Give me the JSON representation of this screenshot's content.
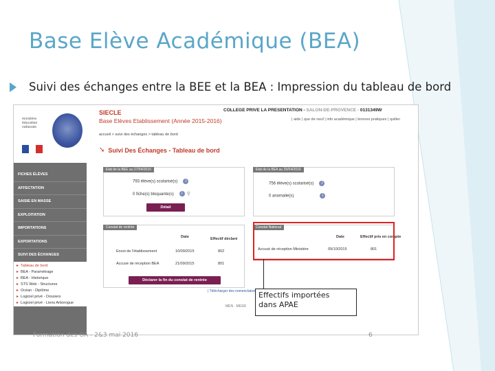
{
  "slide": {
    "title": "Base Elève Académique (BEA)",
    "bullet": "Suivi des échanges entre la BEE et la BEA : Impression du tableau de bord",
    "footer": "Formation des OA - 2&3 mai 2016",
    "page_number": "6",
    "callout_line1": "Effectifs importées",
    "callout_line2": "dans APAE"
  },
  "app": {
    "name": "SIECLE",
    "subtitle": "Base Elèves Etablissement (Année 2015-2016)",
    "school": "COLLEGE PRIVE LA PRESENTATION -",
    "city": "SALON-DE-PROVENCE -",
    "uai": "0131349W",
    "top_links": "| aide | que de neuf | info académique | bonnes pratiques | quitter",
    "breadcrumb": "accueil > suivi des échanges > tableau de bord",
    "page_title": "Suivi Des Échanges - Tableau de bord",
    "logo_text": "ministère éducation nationale"
  },
  "sidebar": {
    "items": [
      "FICHES ÉLÈVES",
      "AFFECTATION",
      "SAISIE EN MASSE",
      "EXPLOITATION",
      "IMPORTATIONS",
      "EXPORTATIONS",
      "SUIVI DES ÉCHANGES"
    ],
    "sub_items": [
      "Tableau de bord",
      "BEA - Paramétrage",
      "BEA - Historique",
      "STS Web - Structures",
      "Océan - Diplôme",
      "Logiciel privé - Dossiers",
      "Logiciel privé - Liens Arborogue"
    ]
  },
  "panel_bee": {
    "tab": "Etat de la BEE au 27/04/2016",
    "row1": "793 élève(s) scolarisé(s)",
    "row2": "0 fiche(s) bloquante(s)",
    "button": "Détail"
  },
  "panel_bea": {
    "tab": "Etat de la BEA au 25/04/2016",
    "row1": "756 élève(s) scolarisé(s)",
    "row2": "0 anomalie(s)"
  },
  "panel_constat": {
    "tab": "Constat de rentrée",
    "col_date": "Date",
    "col_effectif": "Effectif déclaré",
    "rows": [
      {
        "label": "Envoi de l'établissement",
        "date": "10/09/2015",
        "value": "802"
      },
      {
        "label": "Accusé de réception BEA",
        "date": "21/09/2015",
        "value": "801"
      }
    ],
    "button": "Déclarer la fin du constat de rentrée"
  },
  "panel_national": {
    "tab": "Constat National",
    "col_date": "Date",
    "col_effectif": "Effectif pris en compte",
    "rows": [
      {
        "label": "Accusé de réception Ministère",
        "date": "09/10/2015",
        "value": "801"
      }
    ]
  },
  "misc": {
    "nomenclature": "| Télécharger des nomenclatures",
    "bottom_links": "MEN · MESR"
  },
  "colors": {
    "accent": "#5aa6c8",
    "brand_red": "#c0392b",
    "button": "#7a1f52",
    "highlight": "#e02020"
  }
}
